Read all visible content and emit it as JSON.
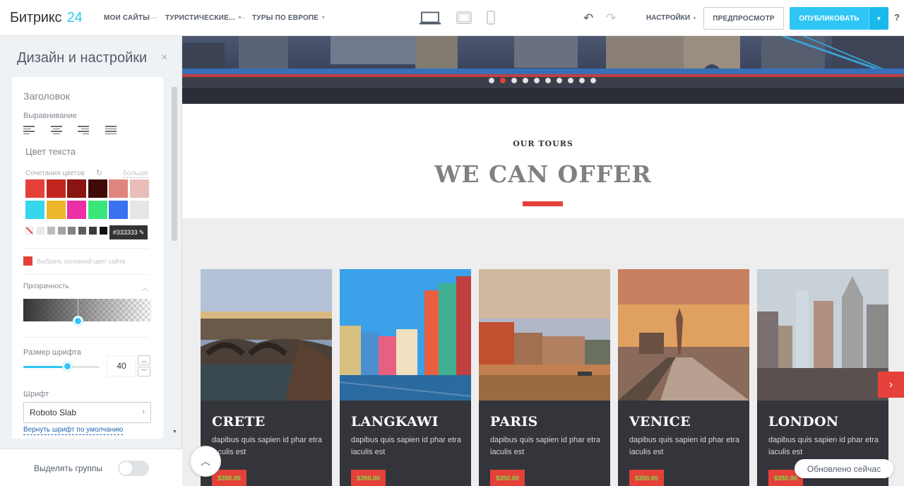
{
  "topbar": {
    "logo_text": "Битрикс",
    "logo_number": "24",
    "nav": [
      "МОИ САЙТЫ",
      "ТУРИСТИЧЕСКИЕ...",
      "ТУРЫ ПО ЕВРОПЕ"
    ],
    "separator": "—",
    "settings_label": "НАСТРОЙКИ",
    "preview_label": "ПРЕДПРОСМОТР",
    "publish_label": "ОПУБЛИКОВАТЬ",
    "help_label": "?",
    "devices": [
      "laptop-icon",
      "tablet-icon",
      "phone-icon"
    ]
  },
  "panel": {
    "title": "Дизайн и настройки",
    "close_icon": "×",
    "section_title": "Заголовок",
    "alignment_label": "Выравнивание",
    "text_color_label": "Цвет текста",
    "color_combinations_label": "Сочетания цветов",
    "more_label": "больше",
    "swatches_row1": [
      "#e6403a",
      "#c3261f",
      "#8b1410",
      "#3f0a08",
      "#e0857e",
      "#e8bdba"
    ],
    "swatches_row2": [
      "#36d6ec",
      "#ecb72b",
      "#eb2fa7",
      "#3ae67a",
      "#3a71ef",
      "#e6e6e6"
    ],
    "grays": [
      "#e8e8e8",
      "#bdbdbd",
      "#a3a3a3",
      "#828282",
      "#5c5c5c",
      "#3a3a3a",
      "#111111"
    ],
    "selected_color": "#333333",
    "base_color_label": "Выбрать основной цвет сайта",
    "opacity_label": "Прозрачность",
    "font_size_label": "Размер шрифта",
    "font_size_value": "40",
    "font_size_fraction": 0.36,
    "font_label": "Шрифт",
    "font_value": "Roboto Slab",
    "reset_font_label": "Вернуть шрифт по умолчанию",
    "group_toggle_label": "Выделять группы",
    "group_toggle_on": false
  },
  "canvas": {
    "slider_dots": 10,
    "slider_active_index": 1,
    "eyebrow": "OUR TOURS",
    "title": "WE CAN OFFER",
    "accent": "#e6403a",
    "cards": [
      {
        "title": "CRETE",
        "text": "dapibus quis sapien id phar etra iaculis est",
        "price": "$350.00"
      },
      {
        "title": "LANGKAWI",
        "text": "dapibus quis sapien id phar etra iaculis est",
        "price": "$350.00"
      },
      {
        "title": "PARIS",
        "text": "dapibus quis sapien id phar etra iaculis est",
        "price": "$350.00"
      },
      {
        "title": "VENICE",
        "text": "dapibus quis sapien id phar etra iaculis est",
        "price": "$350.00"
      },
      {
        "title": "LONDON",
        "text": "dapibus quis sapien id phar etra iaculis est",
        "price": "$350.00"
      }
    ],
    "toast": "Обновлено сейчас"
  }
}
